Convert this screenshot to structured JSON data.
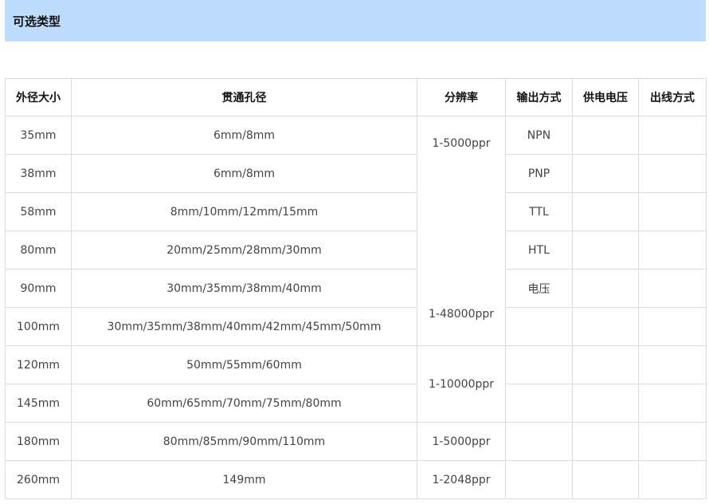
{
  "section": {
    "title": "可选类型"
  },
  "table": {
    "headers": [
      "外径大小",
      "贯通孔径",
      "分辨率",
      "输出方式",
      "供电电压",
      "出线方式"
    ],
    "rows": [
      {
        "outer": "35mm",
        "bore": "6mm/8mm"
      },
      {
        "outer": "38mm",
        "bore": "6mm/8mm"
      },
      {
        "outer": "58mm",
        "bore": "8mm/10mm/12mm/15mm"
      },
      {
        "outer": "80mm",
        "bore": "20mm/25mm/28mm/30mm"
      },
      {
        "outer": "90mm",
        "bore": "30mm/35mm/38mm/40mm"
      },
      {
        "outer": "100mm",
        "bore": "30mm/35mm/38mm/40mm/42mm/45mm/50mm"
      },
      {
        "outer": "120mm",
        "bore": "50mm/55mm/60mm"
      },
      {
        "outer": "145mm",
        "bore": "60mm/65mm/70mm/75mm/80mm"
      },
      {
        "outer": "180mm",
        "bore": "80mm/85mm/90mm/110mm"
      },
      {
        "outer": "260mm",
        "bore": "149mm"
      }
    ],
    "resolution": {
      "group1": "1-5000ppr",
      "group1_bottom": "1-48000ppr",
      "group2": "1-10000ppr",
      "row9": "1-5000ppr",
      "row10": "1-2048ppr"
    },
    "output": [
      "NPN",
      "PNP",
      "TTL",
      "HTL",
      "电压"
    ]
  }
}
